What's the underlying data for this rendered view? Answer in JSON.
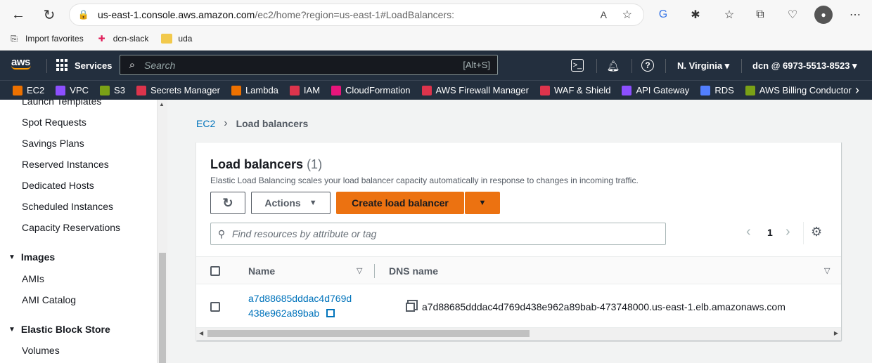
{
  "browser": {
    "url_host": "us-east-1.console.aws.amazon.com",
    "url_path": "/ec2/home?region=us-east-1#LoadBalancers:",
    "favorites": [
      {
        "label": "Import favorites",
        "icon": "import-icon"
      },
      {
        "label": "dcn-slack",
        "icon": "slack-icon"
      },
      {
        "label": "uda",
        "icon": "folder-icon"
      }
    ]
  },
  "aws_nav": {
    "logo": "aws",
    "services_label": "Services",
    "search_placeholder": "Search",
    "search_shortcut": "[Alt+S]",
    "region": "N. Virginia",
    "account": "dcn @ 6973-5513-8523"
  },
  "fav_services": [
    {
      "label": "EC2",
      "color": "#ed7100"
    },
    {
      "label": "VPC",
      "color": "#8c4fff"
    },
    {
      "label": "S3",
      "color": "#7aa116"
    },
    {
      "label": "Secrets Manager",
      "color": "#dd344c"
    },
    {
      "label": "Lambda",
      "color": "#ed7100"
    },
    {
      "label": "IAM",
      "color": "#dd344c"
    },
    {
      "label": "CloudFormation",
      "color": "#e7157b"
    },
    {
      "label": "AWS Firewall Manager",
      "color": "#dd344c"
    },
    {
      "label": "WAF & Shield",
      "color": "#dd344c"
    },
    {
      "label": "API Gateway",
      "color": "#8c4fff"
    },
    {
      "label": "RDS",
      "color": "#527fff"
    },
    {
      "label": "AWS Billing Conductor",
      "color": "#7aa116"
    }
  ],
  "sidebar": {
    "cut_item": "Launch Templates",
    "instances_items": [
      "Spot Requests",
      "Savings Plans",
      "Reserved Instances",
      "Dedicated Hosts",
      "Scheduled Instances",
      "Capacity Reservations"
    ],
    "images_head": "Images",
    "images_items": [
      "AMIs",
      "AMI Catalog"
    ],
    "ebs_head": "Elastic Block Store",
    "ebs_items": [
      "Volumes"
    ]
  },
  "breadcrumb": {
    "root": "EC2",
    "current": "Load balancers"
  },
  "panel": {
    "title": "Load balancers",
    "count": "(1)",
    "description": "Elastic Load Balancing scales your load balancer capacity automatically in response to changes in incoming traffic.",
    "actions_label": "Actions",
    "create_label": "Create load balancer",
    "filter_placeholder": "Find resources by attribute or tag",
    "page_number": "1",
    "columns": [
      "Name",
      "DNS name"
    ],
    "rows": [
      {
        "name_line1": "a7d88685dddac4d769d",
        "name_line2": "438e962a89bab",
        "dns": "a7d88685dddac4d769d438e962a89bab-473748000.us-east-1.elb.amazonaws.com"
      }
    ]
  },
  "colors": {
    "aws_orange": "#ec7211",
    "nav_bg": "#232f3e",
    "link": "#0073bb"
  }
}
